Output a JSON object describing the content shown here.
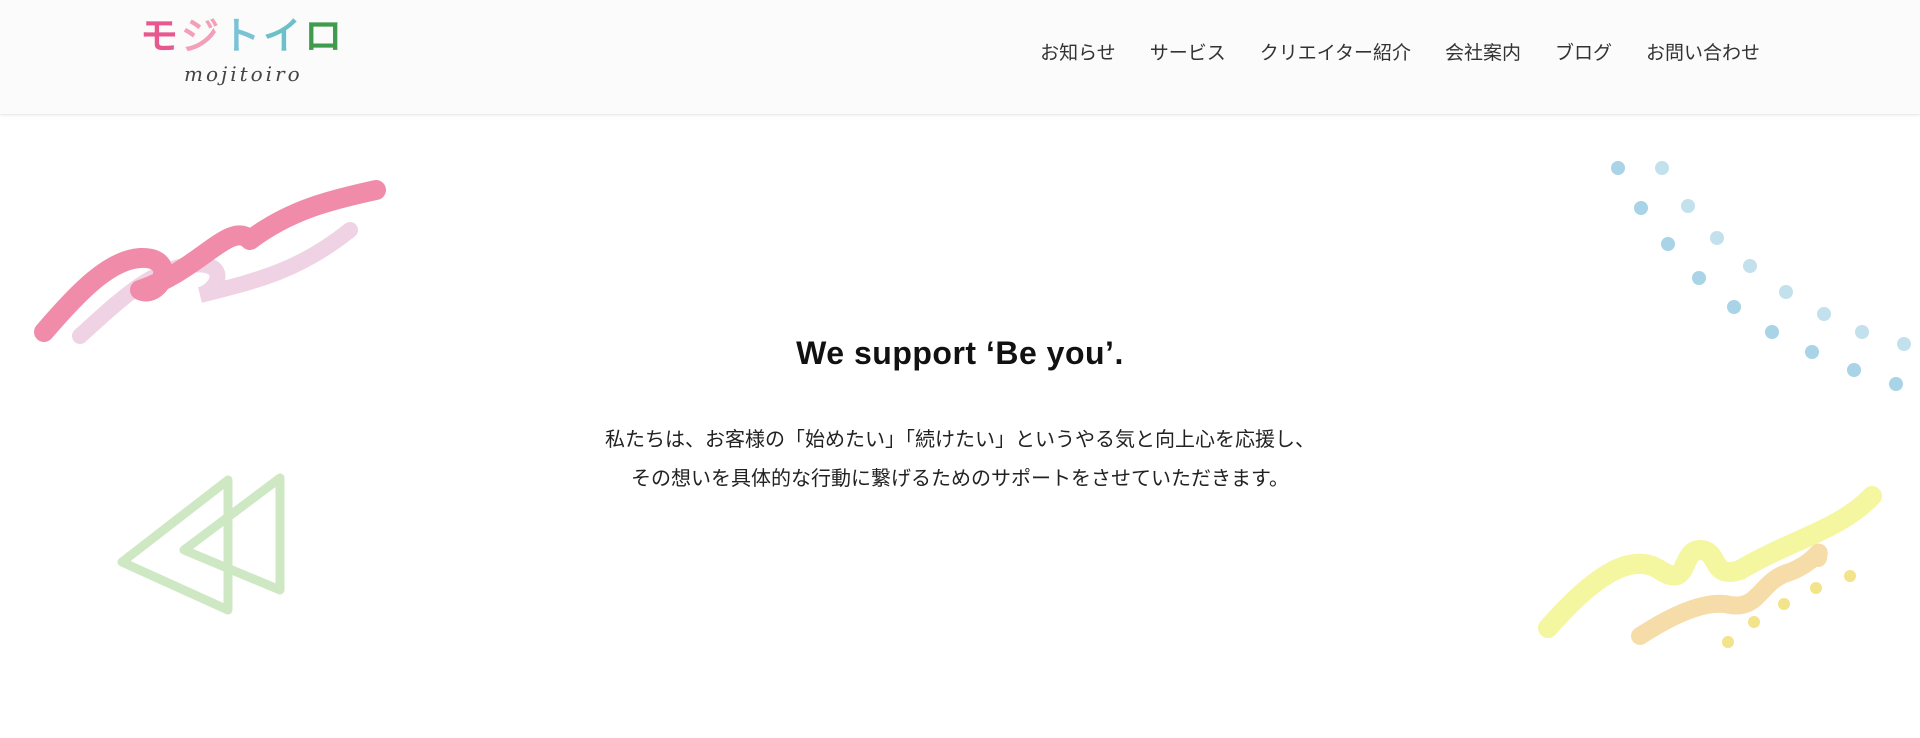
{
  "header": {
    "logo": {
      "kana": [
        "モ",
        "ジ",
        "ト",
        "イ",
        "ロ"
      ],
      "roman": "mojitoiro"
    },
    "nav": [
      {
        "label": "お知らせ"
      },
      {
        "label": "サービス"
      },
      {
        "label": "クリエイター紹介"
      },
      {
        "label": "会社案内"
      },
      {
        "label": "ブログ"
      },
      {
        "label": "お問い合わせ"
      }
    ]
  },
  "hero": {
    "title": "We support ‘Be you’.",
    "lines": [
      "私たちは、お客様の「始めたい」「続けたい」というやる気と向上心を応援し、",
      "その想いを具体的な行動に繋げるためのサポートをさせていただきます。"
    ]
  },
  "colors": {
    "pink_stroke": "#f08caa",
    "light_pink_stroke": "#efd2e4",
    "green_triangles": "#cfe8c4",
    "blue_dots": "#a9d3e6",
    "yellow_stroke": "#f5f6a0",
    "peach_stroke": "#f6dca8",
    "yellow_dots": "#f3e38a"
  }
}
